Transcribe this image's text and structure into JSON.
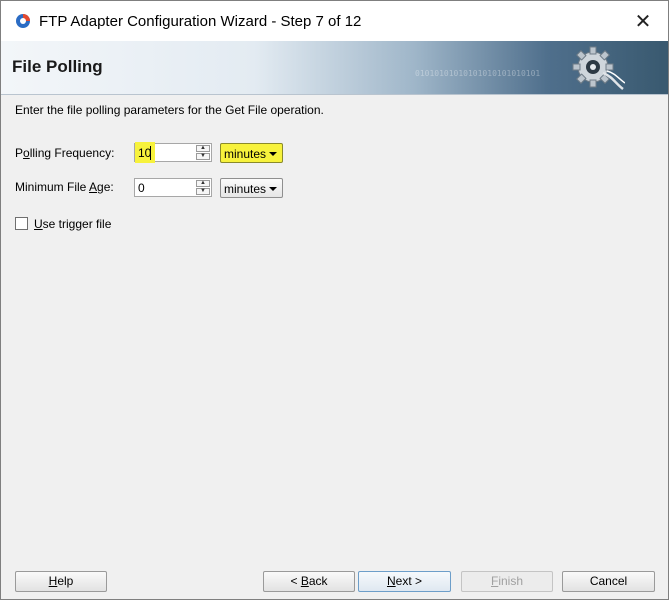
{
  "window": {
    "title": "FTP Adapter Configuration Wizard - Step 7 of 12",
    "close_glyph": "✕"
  },
  "banner": {
    "title": "File Polling",
    "binary_text": "01010101010101010101010101"
  },
  "instructions": "Enter the file polling parameters for the Get File operation.",
  "polling_frequency": {
    "label_pre": "P",
    "label_mnemonic": "o",
    "label_post": "lling Frequency:",
    "value": "10",
    "unit": "minutes"
  },
  "minimum_file_age": {
    "label_pre": "Minimum File ",
    "label_mnemonic": "A",
    "label_post": "ge:",
    "value": "0",
    "unit": "minutes"
  },
  "trigger": {
    "label_mnemonic": "U",
    "label_post": "se trigger file",
    "checked": false
  },
  "buttons": {
    "help": {
      "mnemonic": "H",
      "rest": "elp"
    },
    "back": {
      "pre": "< ",
      "mnemonic": "B",
      "rest": "ack"
    },
    "next": {
      "mnemonic": "N",
      "rest": "ext >"
    },
    "finish": {
      "mnemonic": "F",
      "rest": "inish"
    },
    "cancel": "Cancel"
  },
  "colors": {
    "highlight": "#f7f23c",
    "banner_dark": "#39596f"
  }
}
